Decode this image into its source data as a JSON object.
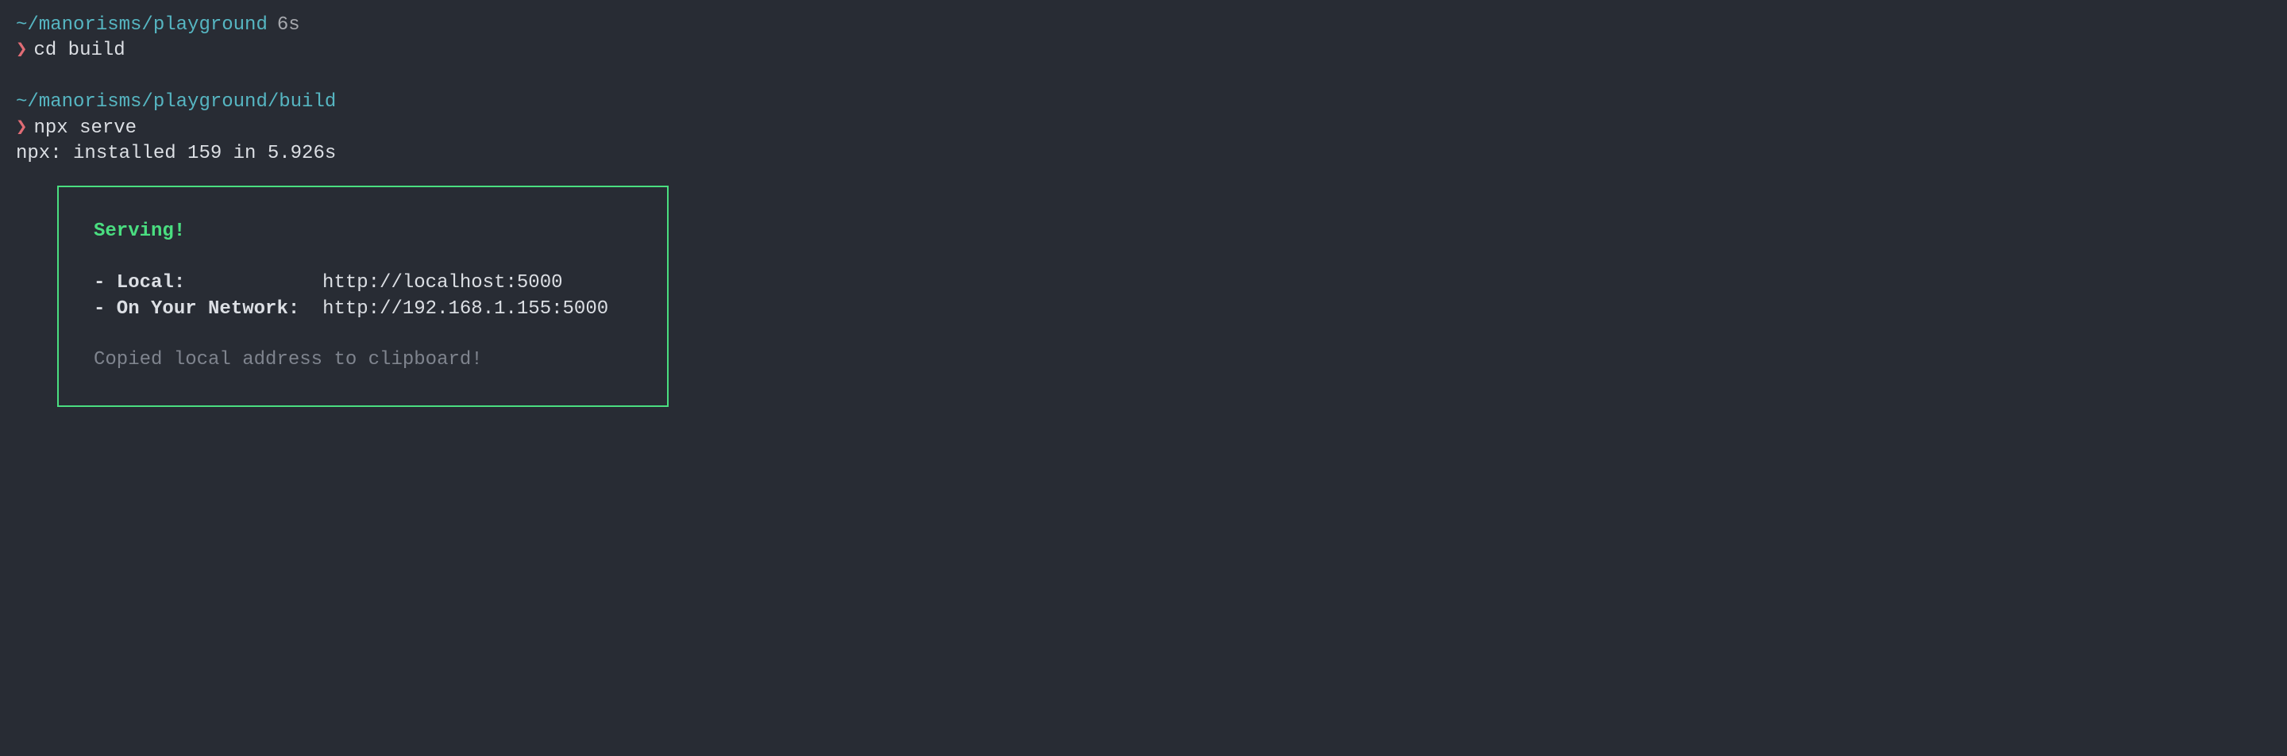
{
  "prompt1": {
    "path": "~/manorisms/playground",
    "time": "6s",
    "chevron": "❯",
    "command": "cd build"
  },
  "prompt2": {
    "path": "~/manorisms/playground/build",
    "chevron": "❯",
    "command": "npx serve"
  },
  "output": {
    "install_line": "npx: installed 159 in 5.926s"
  },
  "serve": {
    "title": "Serving!",
    "local_label": "- Local:",
    "local_url": "http://localhost:5000",
    "network_label": "- On Your Network:",
    "network_url": "http://192.168.1.155:5000",
    "copied_msg": "Copied local address to clipboard!"
  }
}
